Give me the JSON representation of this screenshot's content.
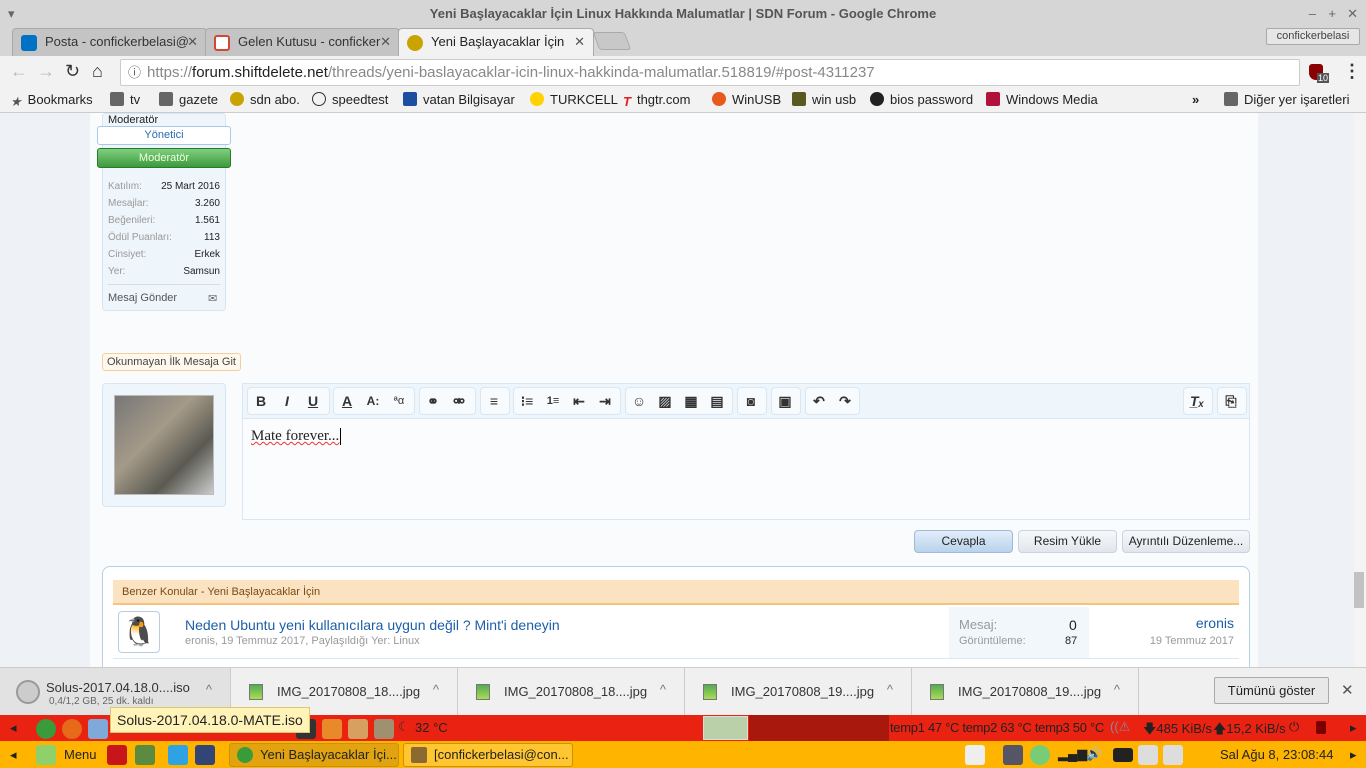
{
  "window": {
    "title": "Yeni Başlayacaklar İçin Linux Hakkında Malumatlar | SDN Forum - Google Chrome",
    "minimize": "–",
    "maximize": "+",
    "close": "✕",
    "menu": "▾"
  },
  "tabs": [
    {
      "label": "Posta - confickerbelasi@",
      "color": "#0072c6"
    },
    {
      "label": "Gelen Kutusu - conficker",
      "color": "#d44638"
    },
    {
      "label": "Yeni Başlayacaklar İçin",
      "color": "#c9a400"
    }
  ],
  "profile": "confickerbelasi",
  "url": {
    "scheme": "https://",
    "host": "forum.shiftdelete.net",
    "path": "/threads/yeni-baslayacaklar-icin-linux-hakkinda-malumatlar.518819/#post-4311237"
  },
  "extension_badge": "10",
  "bookmarks": [
    "Bookmarks",
    "tv",
    "gazete",
    "sdn abo.",
    "speedtest",
    "vatan Bilgisayar",
    "TURKCELL",
    "thgtr.com",
    "WinUSB",
    "win usb",
    "bios password",
    "Windows Media"
  ],
  "bookmarks_overflow": "»",
  "other_bookmarks": "Diğer yer işaretleri",
  "user_card": {
    "title": "Moderatör",
    "badge1": "Yönetici",
    "badge2": "Moderatör",
    "stats": [
      {
        "label": "Katılım:",
        "value": "25 Mart 2016"
      },
      {
        "label": "Mesajlar:",
        "value": "3.260"
      },
      {
        "label": "Beğenileri:",
        "value": "1.561"
      },
      {
        "label": "Ödül Puanları:",
        "value": "113"
      },
      {
        "label": "Cinsiyet:",
        "value": "Erkek"
      },
      {
        "label": "Yer:",
        "value": "Samsun"
      }
    ],
    "send_message": "Mesaj Gönder"
  },
  "unread_link": "Okunmayan İlk Mesaja Git",
  "editor": {
    "content": "Mate forever...",
    "buttons": {
      "reply": "Cevapla",
      "upload": "Resim Yükle",
      "advanced": "Ayrıntılı Düzenleme..."
    }
  },
  "similar": {
    "header": "Benzer Konular - Yeni Başlayacaklar İçin",
    "threads": [
      {
        "title": "Neden Ubuntu yeni kullanıcılara uygun değil ? Mint'i deneyin",
        "meta": "eronis, 19 Temmuz 2017, Paylaşıldığı Yer: Linux",
        "replies_label": "Mesaj:",
        "replies": "0",
        "views_label": "Görüntüleme:",
        "views": "87",
        "last_user": "eronis",
        "last_date": "19 Temmuz 2017"
      }
    ]
  },
  "downloads": [
    {
      "name": "Solus-2017.04.18.0....iso",
      "status": "0,4/1,2 GB, 25 dk. kaldı"
    },
    {
      "name": "IMG_20170808_18....jpg"
    },
    {
      "name": "IMG_20170808_18....jpg"
    },
    {
      "name": "IMG_20170808_19....jpg"
    },
    {
      "name": "IMG_20170808_19....jpg"
    }
  ],
  "show_all": "Tümünü göster",
  "tooltip": "Solus-2017.04.18.0-MATE.iso",
  "panel_top": {
    "weather": "32 °C",
    "temps": "temp1 47 °C temp2 63 °C temp3 50 °C",
    "down": "485 KiB/s",
    "up": "15,2 KiB/s"
  },
  "panel_bottom": {
    "menu": "Menu",
    "tasks": [
      "Yeni Başlayacaklar İçi...",
      "[confickerbelasi@con..."
    ],
    "clock": "Sal Ağu  8, 23:08:44"
  }
}
